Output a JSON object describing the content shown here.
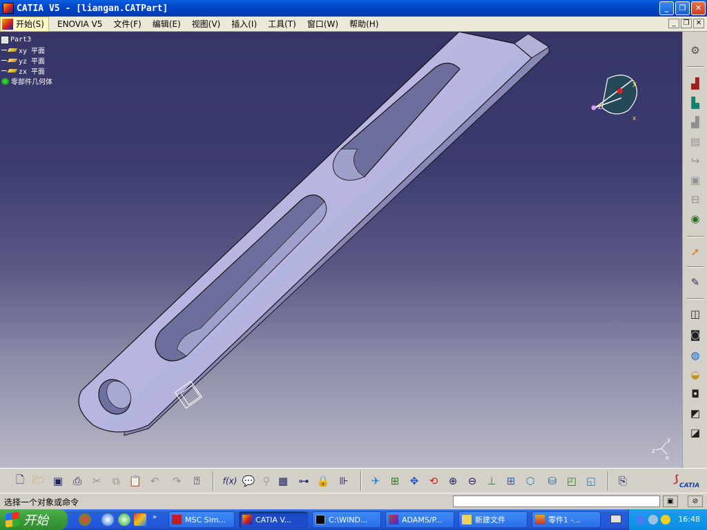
{
  "window": {
    "title": "CATIA V5 - [liangan.CATPart]",
    "minimize": "_",
    "restore": "❐",
    "close": "✕"
  },
  "menubar": {
    "start": "开始(S)",
    "items": [
      "ENOVIA V5",
      "文件(F)",
      "编辑(E)",
      "视图(V)",
      "插入(I)",
      "工具(T)",
      "窗口(W)",
      "帮助(H)"
    ],
    "mdi_min": "_",
    "mdi_restore": "❐",
    "mdi_close": "✕"
  },
  "tree": {
    "root": "Part3",
    "items": [
      "xy 平面",
      "yz 平面",
      "zx 平面",
      "零部件几何体"
    ]
  },
  "compass": {
    "axis_x": "X",
    "axis_y": "Y",
    "axis_z": "Z",
    "axis_x_lower": "x"
  },
  "axis_triad": {
    "x": "x",
    "y": "y",
    "z": "z"
  },
  "status": {
    "message": "选择一个对象或命令",
    "command_value": ""
  },
  "bottom_toolbar": {
    "formula_label": "f(x)"
  },
  "catia_logo": "CATIA",
  "taskbar": {
    "start": "开始",
    "tasks": [
      "MSC Sim...",
      "CATIA V...",
      "C:\\WIND...",
      "ADAMS/P...",
      "新建文件",
      "零件1 -..."
    ],
    "clock": "16:48"
  },
  "colors": {
    "part_face": "#b8b8e0",
    "part_side": "#8484b4",
    "viewport_top": "#363566",
    "viewport_bottom": "#b9b9c6"
  }
}
